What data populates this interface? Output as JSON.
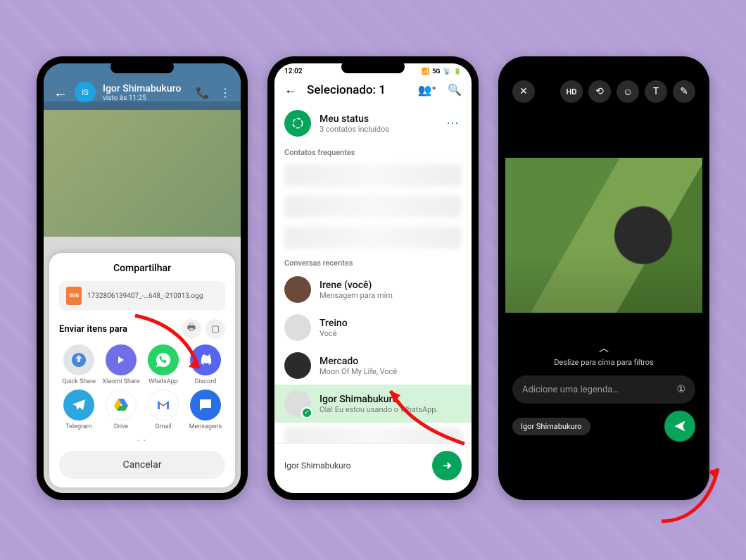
{
  "phone1": {
    "header": {
      "name": "Igor Shimabukuro",
      "seen": "visto às 11:25",
      "avatar_initials": "IS"
    },
    "share": {
      "title": "Compartilhar",
      "file_name": "1732806139407_-…648_-210013.ogg",
      "file_badge": "OGG",
      "send_to_label": "Enviar itens para",
      "apps": [
        {
          "label": "Quick Share",
          "color": "#e1e5ea",
          "icon": "quickshare"
        },
        {
          "label": "Xiaomi Share",
          "color": "#6f6fe8",
          "icon": "xiaomi"
        },
        {
          "label": "WhatsApp",
          "color": "#25d366",
          "icon": "whatsapp"
        },
        {
          "label": "Discord",
          "color": "#5865f2",
          "icon": "discord"
        },
        {
          "label": "Telegram",
          "color": "#2da5df",
          "icon": "telegram"
        },
        {
          "label": "Drive",
          "color": "#ffffff",
          "icon": "drive"
        },
        {
          "label": "Gmail",
          "color": "#ffffff",
          "icon": "gmail"
        },
        {
          "label": "Mensagens",
          "color": "#2b6fe8",
          "icon": "messages"
        }
      ],
      "cancel": "Cancelar"
    }
  },
  "phone2": {
    "status_time": "12:02",
    "status_net": "5G",
    "title": "Selecionado: 1",
    "my_status": {
      "title": "Meu status",
      "subtitle": "3 contatos incluídos"
    },
    "section_frequent": "Contatos frequentes",
    "section_recent": "Conversas recentes",
    "rows": [
      {
        "name": "Irene (você)",
        "sub": "Mensagem para mim"
      },
      {
        "name": "Treino",
        "sub": "Você"
      },
      {
        "name": "Mercado",
        "sub": "Moon Of My Life, Você"
      },
      {
        "name": "Igor Shimabukuro",
        "sub": "Olá! Eu estou usando o WhatsApp.",
        "selected": true
      }
    ],
    "bottom_chip": "Igor Shimabukuro"
  },
  "phone3": {
    "swipe_hint": "Deslize para cima para filtros",
    "caption_placeholder": "Adicione uma legenda…",
    "toolbar": {
      "hd": "HD"
    },
    "recipient": "Igor Shimabukuro"
  }
}
